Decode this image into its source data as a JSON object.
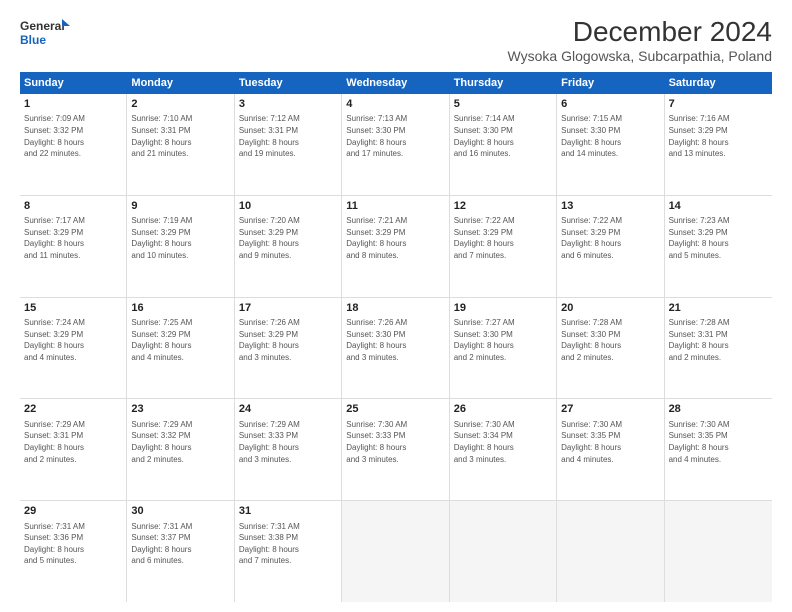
{
  "logo": {
    "line1": "General",
    "line2": "Blue"
  },
  "title": "December 2024",
  "subtitle": "Wysoka Glogowska, Subcarpathia, Poland",
  "header_days": [
    "Sunday",
    "Monday",
    "Tuesday",
    "Wednesday",
    "Thursday",
    "Friday",
    "Saturday"
  ],
  "weeks": [
    [
      {
        "day": "1",
        "info": "Sunrise: 7:09 AM\nSunset: 3:32 PM\nDaylight: 8 hours\nand 22 minutes."
      },
      {
        "day": "2",
        "info": "Sunrise: 7:10 AM\nSunset: 3:31 PM\nDaylight: 8 hours\nand 21 minutes."
      },
      {
        "day": "3",
        "info": "Sunrise: 7:12 AM\nSunset: 3:31 PM\nDaylight: 8 hours\nand 19 minutes."
      },
      {
        "day": "4",
        "info": "Sunrise: 7:13 AM\nSunset: 3:30 PM\nDaylight: 8 hours\nand 17 minutes."
      },
      {
        "day": "5",
        "info": "Sunrise: 7:14 AM\nSunset: 3:30 PM\nDaylight: 8 hours\nand 16 minutes."
      },
      {
        "day": "6",
        "info": "Sunrise: 7:15 AM\nSunset: 3:30 PM\nDaylight: 8 hours\nand 14 minutes."
      },
      {
        "day": "7",
        "info": "Sunrise: 7:16 AM\nSunset: 3:29 PM\nDaylight: 8 hours\nand 13 minutes."
      }
    ],
    [
      {
        "day": "8",
        "info": "Sunrise: 7:17 AM\nSunset: 3:29 PM\nDaylight: 8 hours\nand 11 minutes."
      },
      {
        "day": "9",
        "info": "Sunrise: 7:19 AM\nSunset: 3:29 PM\nDaylight: 8 hours\nand 10 minutes."
      },
      {
        "day": "10",
        "info": "Sunrise: 7:20 AM\nSunset: 3:29 PM\nDaylight: 8 hours\nand 9 minutes."
      },
      {
        "day": "11",
        "info": "Sunrise: 7:21 AM\nSunset: 3:29 PM\nDaylight: 8 hours\nand 8 minutes."
      },
      {
        "day": "12",
        "info": "Sunrise: 7:22 AM\nSunset: 3:29 PM\nDaylight: 8 hours\nand 7 minutes."
      },
      {
        "day": "13",
        "info": "Sunrise: 7:22 AM\nSunset: 3:29 PM\nDaylight: 8 hours\nand 6 minutes."
      },
      {
        "day": "14",
        "info": "Sunrise: 7:23 AM\nSunset: 3:29 PM\nDaylight: 8 hours\nand 5 minutes."
      }
    ],
    [
      {
        "day": "15",
        "info": "Sunrise: 7:24 AM\nSunset: 3:29 PM\nDaylight: 8 hours\nand 4 minutes."
      },
      {
        "day": "16",
        "info": "Sunrise: 7:25 AM\nSunset: 3:29 PM\nDaylight: 8 hours\nand 4 minutes."
      },
      {
        "day": "17",
        "info": "Sunrise: 7:26 AM\nSunset: 3:29 PM\nDaylight: 8 hours\nand 3 minutes."
      },
      {
        "day": "18",
        "info": "Sunrise: 7:26 AM\nSunset: 3:30 PM\nDaylight: 8 hours\nand 3 minutes."
      },
      {
        "day": "19",
        "info": "Sunrise: 7:27 AM\nSunset: 3:30 PM\nDaylight: 8 hours\nand 2 minutes."
      },
      {
        "day": "20",
        "info": "Sunrise: 7:28 AM\nSunset: 3:30 PM\nDaylight: 8 hours\nand 2 minutes."
      },
      {
        "day": "21",
        "info": "Sunrise: 7:28 AM\nSunset: 3:31 PM\nDaylight: 8 hours\nand 2 minutes."
      }
    ],
    [
      {
        "day": "22",
        "info": "Sunrise: 7:29 AM\nSunset: 3:31 PM\nDaylight: 8 hours\nand 2 minutes."
      },
      {
        "day": "23",
        "info": "Sunrise: 7:29 AM\nSunset: 3:32 PM\nDaylight: 8 hours\nand 2 minutes."
      },
      {
        "day": "24",
        "info": "Sunrise: 7:29 AM\nSunset: 3:33 PM\nDaylight: 8 hours\nand 3 minutes."
      },
      {
        "day": "25",
        "info": "Sunrise: 7:30 AM\nSunset: 3:33 PM\nDaylight: 8 hours\nand 3 minutes."
      },
      {
        "day": "26",
        "info": "Sunrise: 7:30 AM\nSunset: 3:34 PM\nDaylight: 8 hours\nand 3 minutes."
      },
      {
        "day": "27",
        "info": "Sunrise: 7:30 AM\nSunset: 3:35 PM\nDaylight: 8 hours\nand 4 minutes."
      },
      {
        "day": "28",
        "info": "Sunrise: 7:30 AM\nSunset: 3:35 PM\nDaylight: 8 hours\nand 4 minutes."
      }
    ],
    [
      {
        "day": "29",
        "info": "Sunrise: 7:31 AM\nSunset: 3:36 PM\nDaylight: 8 hours\nand 5 minutes."
      },
      {
        "day": "30",
        "info": "Sunrise: 7:31 AM\nSunset: 3:37 PM\nDaylight: 8 hours\nand 6 minutes."
      },
      {
        "day": "31",
        "info": "Sunrise: 7:31 AM\nSunset: 3:38 PM\nDaylight: 8 hours\nand 7 minutes."
      },
      {
        "day": "",
        "info": ""
      },
      {
        "day": "",
        "info": ""
      },
      {
        "day": "",
        "info": ""
      },
      {
        "day": "",
        "info": ""
      }
    ]
  ]
}
